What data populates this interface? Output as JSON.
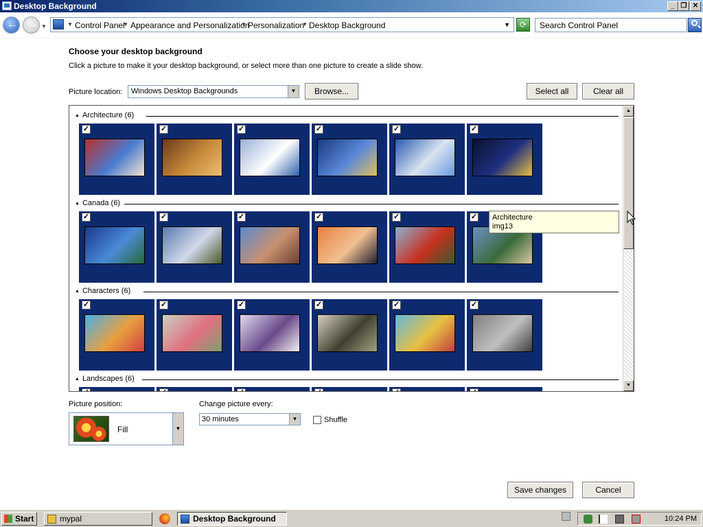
{
  "window": {
    "title": "Desktop Background",
    "minimize": "_",
    "restore": "❐",
    "close": "✕"
  },
  "address_bar": {
    "breadcrumbs": [
      "Control Panel",
      "Appearance and Personalization",
      "Personalization",
      "Desktop Background"
    ],
    "search_placeholder": "Search Control Panel"
  },
  "content": {
    "heading": "Choose your desktop background",
    "subtext": "Click a picture to make it your desktop background, or select more than one picture to create a slide show.",
    "picture_location_label": "Picture location:",
    "picture_location_value": "Windows Desktop Backgrounds",
    "browse_button": "Browse...",
    "select_all_button": "Select all",
    "clear_all_button": "Clear all"
  },
  "gallery": {
    "groups": [
      {
        "name": "Architecture (6)",
        "images": [
          {
            "checked": true,
            "colors": [
              "#b8302a",
              "#4a7bd0",
              "#f0e4d0"
            ]
          },
          {
            "checked": true,
            "colors": [
              "#6a3a1a",
              "#c88a3a",
              "#e8c070"
            ]
          },
          {
            "checked": true,
            "colors": [
              "#9ab0d8",
              "#ffffff",
              "#3060a8"
            ]
          },
          {
            "checked": true,
            "colors": [
              "#1a3a80",
              "#5a88d8",
              "#e0c060"
            ]
          },
          {
            "checked": true,
            "colors": [
              "#2a5ab0",
              "#d8e4f0",
              "#6a98e0"
            ]
          },
          {
            "checked": true,
            "colors": [
              "#0a1030",
              "#203080",
              "#e8c040"
            ]
          }
        ]
      },
      {
        "name": "Canada (6)",
        "images": [
          {
            "checked": true,
            "colors": [
              "#1a3a8a",
              "#4a8ad8",
              "#2a6a3a"
            ]
          },
          {
            "checked": true,
            "colors": [
              "#5a7ab0",
              "#d0d8e8",
              "#4a5a2a"
            ]
          },
          {
            "checked": true,
            "colors": [
              "#5a8ad0",
              "#c89070",
              "#6a4030"
            ]
          },
          {
            "checked": true,
            "colors": [
              "#e88040",
              "#f0c090",
              "#202030"
            ]
          },
          {
            "checked": true,
            "colors": [
              "#8ab0d0",
              "#c83020",
              "#3a5a2a"
            ]
          },
          {
            "checked": true,
            "colors": [
              "#6a90c8",
              "#3a6a3a",
              "#d8c8a0"
            ]
          }
        ]
      },
      {
        "name": "Characters (6)",
        "images": [
          {
            "checked": true,
            "colors": [
              "#4ab0e8",
              "#e8a040",
              "#d04040"
            ]
          },
          {
            "checked": true,
            "colors": [
              "#c8d0c0",
              "#e07080",
              "#80a070"
            ]
          },
          {
            "checked": true,
            "colors": [
              "#e0d8f0",
              "#6a4a8a",
              "#f0f0f0"
            ]
          },
          {
            "checked": true,
            "colors": [
              "#d8d0c0",
              "#404030",
              "#a0a080"
            ]
          },
          {
            "checked": true,
            "colors": [
              "#60b8e0",
              "#e8c040",
              "#c04040"
            ]
          },
          {
            "checked": true,
            "colors": [
              "#808080",
              "#c0c0c0",
              "#404040"
            ]
          }
        ]
      },
      {
        "name": "Landscapes (6)",
        "images": [
          {
            "checked": true,
            "colors": [
              "#4a7ab0",
              "#8ab060",
              "#f0e0a0"
            ]
          },
          {
            "checked": true,
            "colors": [
              "#4a7ab0",
              "#8ab060",
              "#f0e0a0"
            ]
          },
          {
            "checked": true,
            "colors": [
              "#4a7ab0",
              "#8ab060",
              "#f0e0a0"
            ]
          },
          {
            "checked": true,
            "colors": [
              "#4a7ab0",
              "#8ab060",
              "#f0e0a0"
            ]
          },
          {
            "checked": true,
            "colors": [
              "#4a7ab0",
              "#8ab060",
              "#f0e0a0"
            ]
          },
          {
            "checked": true,
            "colors": [
              "#4a7ab0",
              "#8ab060",
              "#f0e0a0"
            ]
          }
        ]
      }
    ],
    "tooltip": {
      "line1": "Architecture",
      "line2": "img13"
    }
  },
  "position": {
    "label": "Picture position:",
    "value": "Fill"
  },
  "change_every": {
    "label": "Change picture every:",
    "value": "30 minutes"
  },
  "shuffle": {
    "label": "Shuffle",
    "checked": false
  },
  "footer": {
    "save_button": "Save changes",
    "cancel_button": "Cancel"
  },
  "taskbar": {
    "start_label": "Start",
    "tasks": [
      {
        "label": "mypal",
        "active": false
      },
      {
        "label": "Desktop Background",
        "active": true
      }
    ],
    "clock": "10:24 PM"
  },
  "colors": {
    "tile_bg": "#0e2a6e",
    "title_bar_start": "#0a246a",
    "taskbar_bg": "#d4d0c8"
  }
}
